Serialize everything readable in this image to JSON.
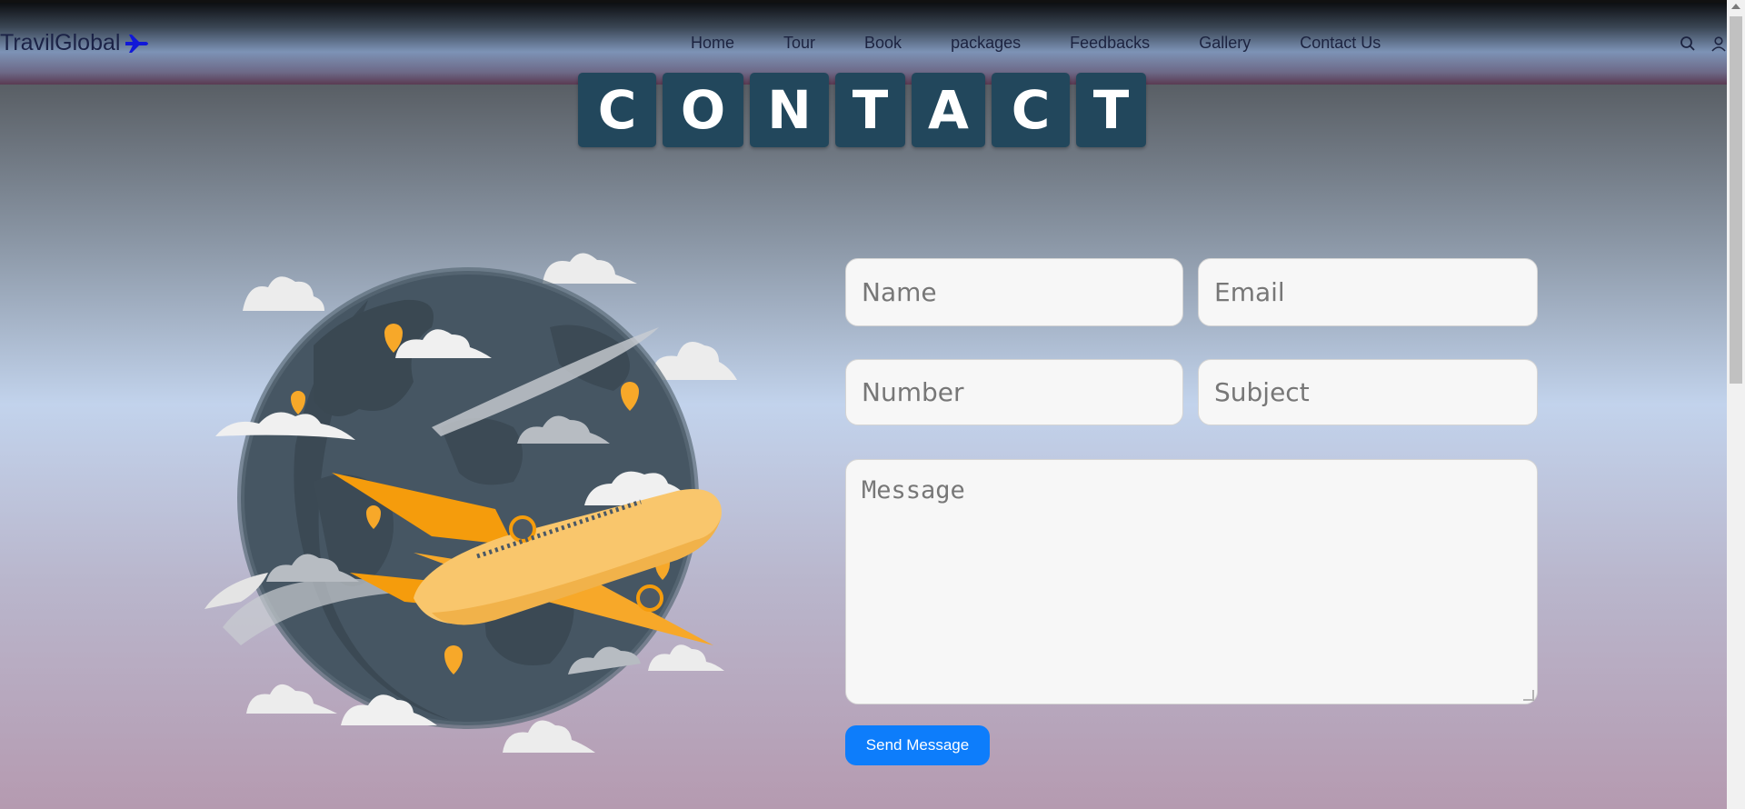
{
  "header": {
    "brand": "TravilGlobal",
    "nav": [
      "Home",
      "Tour",
      "Book",
      "packages",
      "Feedbacks",
      "Gallery",
      "Contact Us"
    ],
    "icons": [
      "search-icon",
      "user-icon",
      "airplane-icon"
    ]
  },
  "title_letters": [
    "C",
    "O",
    "N",
    "T",
    "A",
    "C",
    "T"
  ],
  "form": {
    "name_placeholder": "Name",
    "email_placeholder": "Email",
    "number_placeholder": "Number",
    "subject_placeholder": "Subject",
    "message_placeholder": "Message",
    "submit_label": "Send Message"
  },
  "colors": {
    "title_tile": "#22475c",
    "button": "#0d7dfb",
    "plane": "#f7a829",
    "globe": "#465663"
  }
}
